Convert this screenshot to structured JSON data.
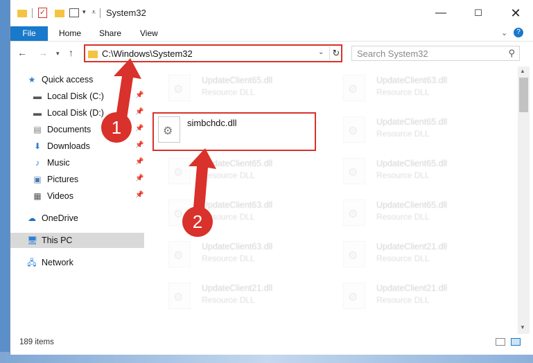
{
  "window": {
    "title": "System32"
  },
  "ribbon": {
    "tabs": [
      "File",
      "Home",
      "Share",
      "View"
    ]
  },
  "address": {
    "path": "C:\\Windows\\System32"
  },
  "search": {
    "placeholder": "Search System32"
  },
  "sidebar": {
    "items": [
      {
        "label": "Quick access",
        "icon": "star-icon"
      },
      {
        "label": "Local Disk (C:)",
        "icon": "drive-icon"
      },
      {
        "label": "Local Disk (D:)",
        "icon": "drive-icon"
      },
      {
        "label": "Documents",
        "icon": "documents-icon"
      },
      {
        "label": "Downloads",
        "icon": "download-icon"
      },
      {
        "label": "Music",
        "icon": "music-icon"
      },
      {
        "label": "Pictures",
        "icon": "pictures-icon"
      },
      {
        "label": "Videos",
        "icon": "videos-icon"
      },
      {
        "label": "OneDrive",
        "icon": "cloud-icon"
      },
      {
        "label": "This PC",
        "icon": "computer-icon"
      },
      {
        "label": "Network",
        "icon": "network-icon"
      }
    ]
  },
  "files": {
    "left": [
      {
        "name": "UpdateClient65.dll",
        "desc": "Resource DLL"
      },
      {
        "name": "UpdateClient65.dll",
        "desc": "Resource DLL"
      },
      {
        "name": "UpdateClient63.dll",
        "desc": "Resource DLL"
      },
      {
        "name": "UpdateClient63.dll",
        "desc": "Resource DLL"
      },
      {
        "name": "UpdateClient21.dll",
        "desc": "Resource DLL"
      }
    ],
    "right": [
      {
        "name": "UpdateClient63.dll",
        "desc": "Resource DLL"
      },
      {
        "name": "UpdateClient65.dll",
        "desc": "Resource DLL"
      },
      {
        "name": "UpdateClient65.dll",
        "desc": "Resource DLL"
      },
      {
        "name": "UpdateClient65.dll",
        "desc": "Resource DLL"
      },
      {
        "name": "UpdateClient21.dll",
        "desc": "Resource DLL"
      },
      {
        "name": "UpdateClient21.dll",
        "desc": "Resource DLL"
      }
    ],
    "highlighted": {
      "name": "simbchdc.dll"
    }
  },
  "status": {
    "count": "189 items"
  },
  "annotations": {
    "step1": "1",
    "step2": "2",
    "color": "#d9312b"
  }
}
